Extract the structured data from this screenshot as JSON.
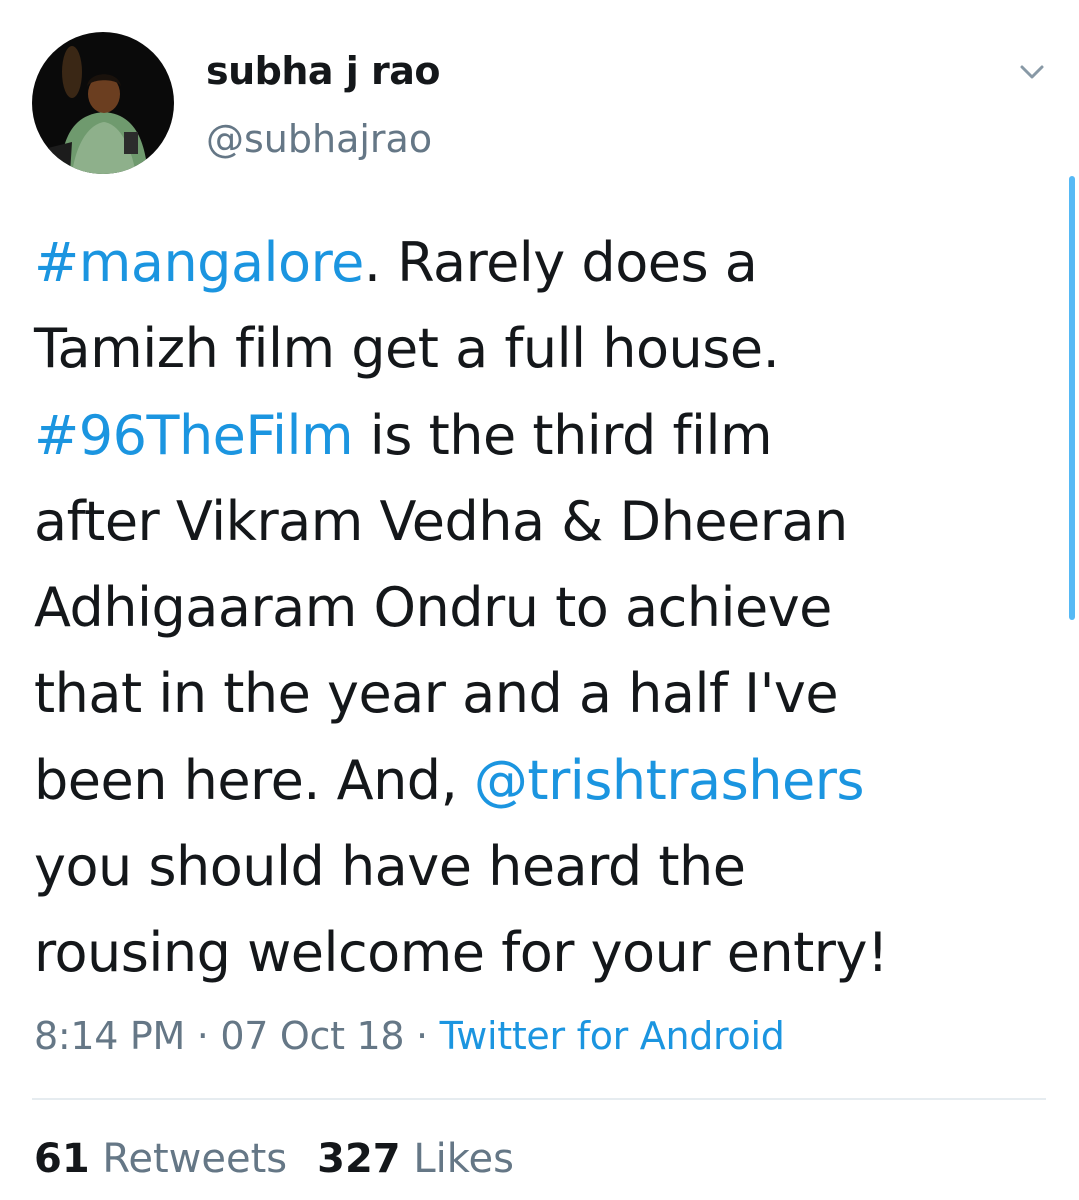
{
  "author": {
    "display_name": "subha j rao",
    "handle": "@subhajrao",
    "avatar_icon": "user-avatar-photo"
  },
  "menu_icon": "chevron-down-icon",
  "tweet": {
    "lines": [
      [
        {
          "text": "#mangalore",
          "link": true
        },
        {
          "text": ". Rarely does a",
          "link": false
        }
      ],
      [
        {
          "text": "Tamizh film get a full house.",
          "link": false
        }
      ],
      [
        {
          "text": "#96TheFilm",
          "link": true
        },
        {
          "text": " is the third film",
          "link": false
        }
      ],
      [
        {
          "text": "after Vikram Vedha &  Dheeran",
          "link": false
        }
      ],
      [
        {
          "text": "Adhigaaram Ondru to achieve",
          "link": false
        }
      ],
      [
        {
          "text": "that in the year and a half I've",
          "link": false
        }
      ],
      [
        {
          "text": "been here. And, ",
          "link": false
        },
        {
          "text": "@trishtrashers",
          "link": true
        }
      ],
      [
        {
          "text": "you should have heard the",
          "link": false
        }
      ],
      [
        {
          "text": "rousing welcome for your entry!",
          "link": false
        }
      ]
    ]
  },
  "meta": {
    "time": "8:14 PM",
    "separator": " · ",
    "date": "07 Oct 18",
    "source": "Twitter for Android"
  },
  "stats": {
    "retweets_count": "61",
    "retweets_label": "Retweets",
    "likes_count": "327",
    "likes_label": "Likes"
  },
  "colors": {
    "link": "#1b95e0",
    "secondary_text": "#657786",
    "primary_text": "#14171a",
    "divider": "#e6ecf0"
  }
}
